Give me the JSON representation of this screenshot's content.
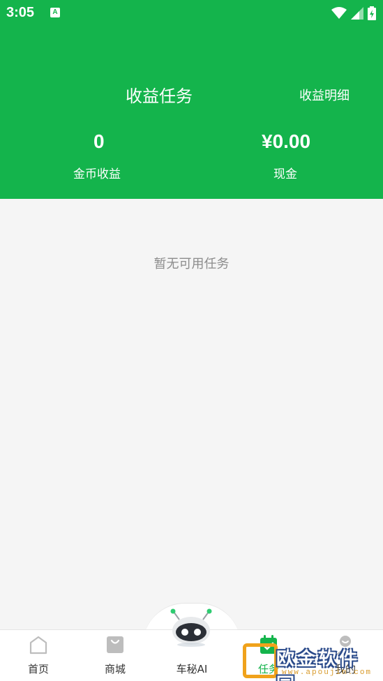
{
  "status_bar": {
    "time": "3:05",
    "badge": "A"
  },
  "header": {
    "title": "收益任务",
    "detail_link": "收益明细",
    "stats": [
      {
        "value": "0",
        "label": "金币收益"
      },
      {
        "value": "¥0.00",
        "label": "现金"
      }
    ]
  },
  "main": {
    "empty_message": "暂无可用任务"
  },
  "tabbar": {
    "tabs": [
      {
        "label": "首页",
        "icon": "home-icon"
      },
      {
        "label": "商城",
        "icon": "bag-icon"
      },
      {
        "label": "车秘AI",
        "icon": "robot-icon"
      },
      {
        "label": "任务",
        "icon": "calendar-check-icon",
        "active": true
      },
      {
        "label": "我的",
        "icon": "user-icon"
      }
    ]
  },
  "watermark": {
    "text": "欧金软件园",
    "url": "www.apoujin.com"
  },
  "colors": {
    "brand_green": "#14b44c",
    "tab_active": "#14b44c",
    "text_muted": "#8c8c8c",
    "watermark_orange": "#f0a21b"
  }
}
